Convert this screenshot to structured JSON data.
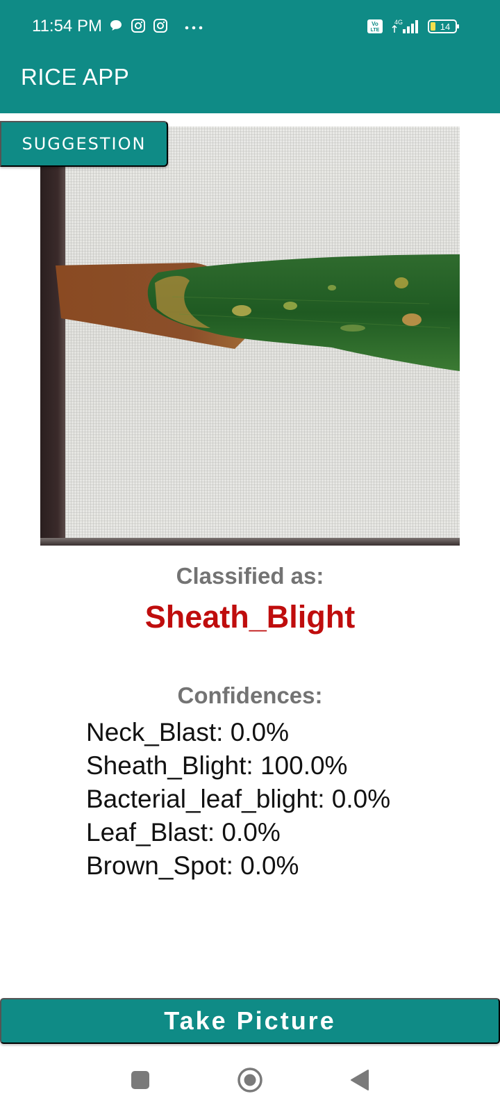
{
  "status_bar": {
    "time": "11:54 PM",
    "left_icons": [
      "chat-bubble-icon",
      "instagram-icon",
      "instagram-icon",
      "more-dots-icon"
    ],
    "right_icons": [
      "volte-icon",
      "4g-signal-icon"
    ],
    "network": "4G",
    "volte": "Vo LTE",
    "battery": "14"
  },
  "app_bar": {
    "title": "RICE APP"
  },
  "suggestion_button": {
    "label": "SUGGESTION"
  },
  "result": {
    "classified_label": "Classified as:",
    "classified_value": "Sheath_Blight",
    "confidences_label": "Confidences:",
    "confidences": [
      {
        "text": "Neck_Blast: 0.0%"
      },
      {
        "text": "Sheath_Blight: 100.0%"
      },
      {
        "text": "Bacterial_leaf_blight: 0.0%"
      },
      {
        "text": "Leaf_Blast: 0.0%"
      },
      {
        "text": "Brown_Spot: 0.0%"
      }
    ]
  },
  "take_picture_button": {
    "label": "Take Picture"
  },
  "nav_bar": {
    "buttons": [
      "recents-square-icon",
      "home-circle-icon",
      "back-triangle-icon"
    ]
  },
  "colors": {
    "primary": "#0f8b86",
    "result_red": "#bf0d0d",
    "label_gray": "#737373"
  }
}
